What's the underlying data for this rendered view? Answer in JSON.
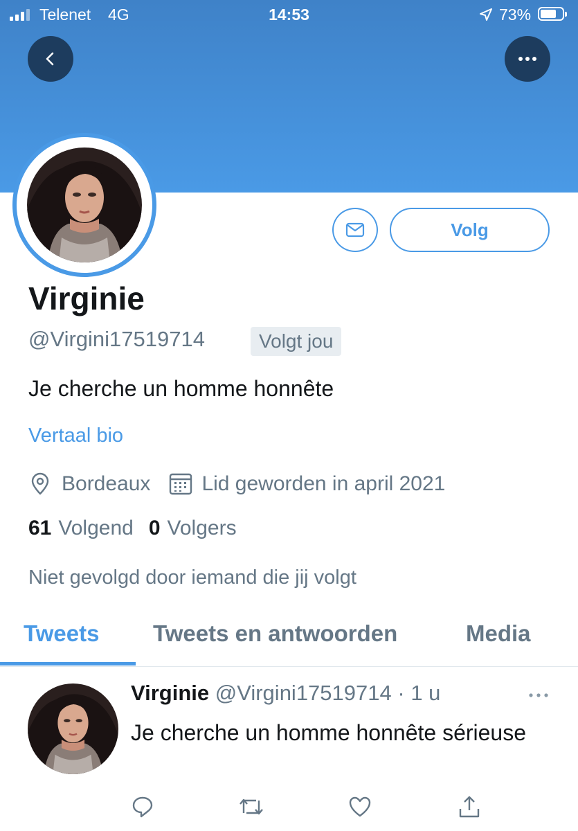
{
  "status_bar": {
    "carrier": "Telenet",
    "network": "4G",
    "time": "14:53",
    "battery": "73%"
  },
  "profile": {
    "name": "Virginie",
    "handle": "@Virgini17519714",
    "follows_you": "Volgt jou",
    "bio": "Je cherche un homme honnête",
    "translate_bio": "Vertaal bio",
    "location": "Bordeaux",
    "joined": "Lid geworden in april 2021",
    "following_count": "61",
    "following_label": "Volgend",
    "followers_count": "0",
    "followers_label": "Volgers",
    "not_followed_by": "Niet gevolgd door iemand die jij volgt",
    "follow_button": "Volg"
  },
  "tabs": [
    {
      "label": "Tweets",
      "active": true
    },
    {
      "label": "Tweets en antwoorden",
      "active": false
    },
    {
      "label": "Media",
      "active": false
    }
  ],
  "tweet": {
    "name": "Virginie",
    "handle": "@Virgini17519714",
    "separator": " · ",
    "time": "1 u",
    "text": "Je cherche un homme honnête sérieuse"
  },
  "icons": {
    "back": "chevron-left-icon",
    "more": "more-horizontal-icon",
    "message": "envelope-icon",
    "location": "location-pin-icon",
    "calendar": "calendar-icon",
    "reply": "reply-icon",
    "retweet": "retweet-icon",
    "like": "heart-icon",
    "share": "share-icon"
  },
  "colors": {
    "accent": "#4a9ae6",
    "banner": "#4a9ae6",
    "secondary_text": "#657786",
    "primary_text": "#14171a"
  }
}
